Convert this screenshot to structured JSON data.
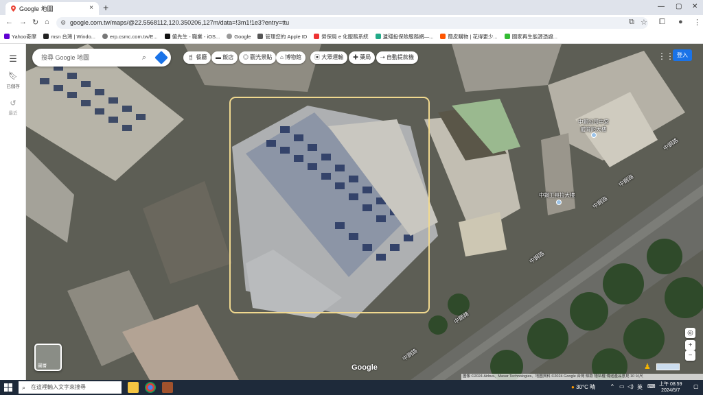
{
  "browser": {
    "tab_title": "Google 地圖",
    "tab_close": "×",
    "new_tab": "+",
    "url": "google.com.tw/maps/@22.5568112,120.350206,127m/data=!3m1!1e3?entry=ttu",
    "bookmarks": [
      "Yahoo奇摩",
      "msn 台灣 | Windo...",
      "erp.csmc.com.tw/E...",
      "僱先生 - 職業 - iOS...",
      "Google",
      "管理您的 Apple ID",
      "勞保局 e 化服務系統",
      "遺殘投保險服務網—...",
      "簡皮購物 | 花得更少...",
      "國家再生能源憑證..."
    ]
  },
  "maps": {
    "search_placeholder": "搜尋 Google 地圖",
    "chips": [
      "餐廳",
      "飯店",
      "觀光景點",
      "博物館",
      "大眾運輸",
      "藥局",
      "自動提款機"
    ],
    "rail": {
      "saved": "已儲存",
      "recents": "最近"
    },
    "login": "登入",
    "layers_label": "圖層",
    "labels": {
      "center": "中鋼公司中安\n體育館大樓",
      "building": "中鋼工具拉大樓"
    },
    "roads": [
      "中鋼路",
      "中鋼路",
      "中鋼路",
      "中鋼路",
      "中鋼路",
      "中鋼路"
    ],
    "logo": "Google",
    "attribution": "圖像 ©2024 Airbus、Maxar Technologies、地圖資料 ©2024 Google   台灣   條款   隱私權   傳送產品意見   10 公尺"
  },
  "taskbar": {
    "search_placeholder": "在這裡輸入文字來搜尋",
    "weather": "30°C 晴",
    "ime": "英",
    "time": "上午 08:59",
    "date": "2024/5/7"
  },
  "colors": {
    "accent": "#1a73e8",
    "highlight_box": "#f1d98f"
  }
}
